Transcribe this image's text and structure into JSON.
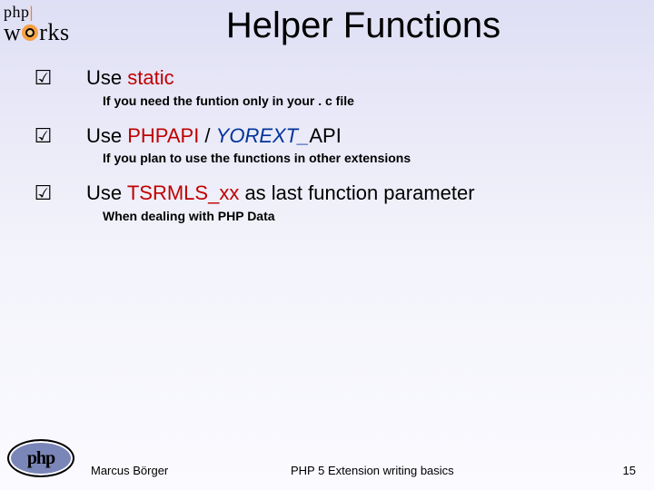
{
  "logo": {
    "line1_a": "php",
    "line1_b": "|",
    "line2_a": "w",
    "line2_c": "rks"
  },
  "title": "Helper Functions",
  "bullets": [
    {
      "check": "☑",
      "main_pre": "Use ",
      "kw": "static",
      "kw_class": "kw-red",
      "main_post": "",
      "sub": "If you need the funtion only in your . c file"
    },
    {
      "check": "☑",
      "main_pre": "Use ",
      "kw": "PHPAPI",
      "kw_class": "kw-red",
      "mid": " / ",
      "kw2": "YOREXT_",
      "kw2_class": "kw-blue kw-italic",
      "kw3": "API",
      "sub": "If you plan to use the functions in other extensions"
    },
    {
      "check": "☑",
      "main_pre": "Use ",
      "kw": "TSRMLS_xx",
      "kw_class": "kw-red",
      "main_post": " as last function parameter",
      "sub": "When dealing with PHP Data"
    }
  ],
  "php_badge": "php",
  "footer": {
    "author": "Marcus Börger",
    "title": "PHP 5 Extension writing basics",
    "page": "15"
  }
}
